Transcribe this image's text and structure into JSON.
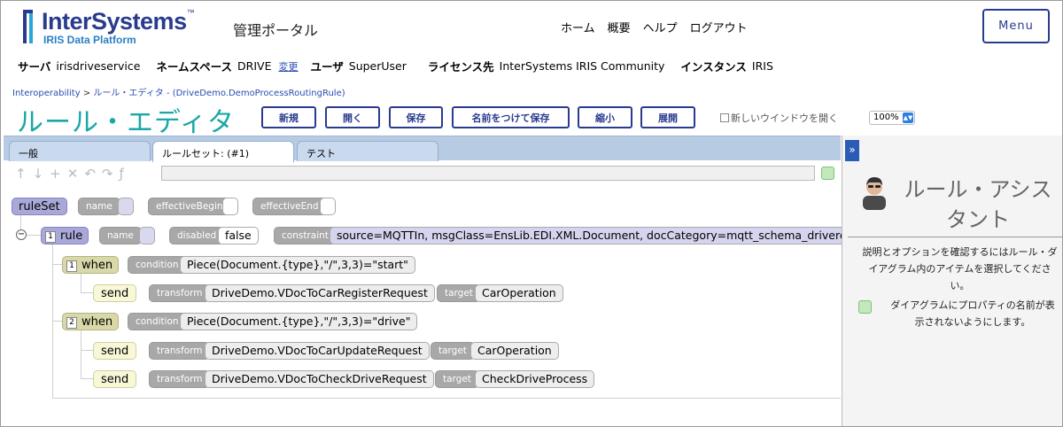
{
  "header": {
    "logo_name": "InterSystems",
    "logo_tm": "™",
    "logo_sub": "IRIS Data Platform",
    "portal_title": "管理ポータル",
    "nav": [
      "ホーム",
      "概要",
      "ヘルプ",
      "ログアウト"
    ],
    "menu_label": "Menu"
  },
  "info": {
    "server_label": "サーバ",
    "server": "irisdriveservice",
    "namespace_label": "ネームスペース",
    "namespace": "DRIVE",
    "change_label": "変更",
    "user_label": "ユーザ",
    "user": "SuperUser",
    "license_label": "ライセンス先",
    "license": "InterSystems IRIS Community",
    "instance_label": "インスタンス",
    "instance": "IRIS"
  },
  "breadcrumb": {
    "root": "Interoperability",
    "sep": ">",
    "current": "ルール・エディタ",
    "detail": " - (DriveDemo.DemoProcessRoutingRule)"
  },
  "page_title": "ルール・エディタ",
  "toolbar": {
    "new": "新規",
    "open": "開く",
    "save": "保存",
    "save_as": "名前をつけて保存",
    "shrink": "縮小",
    "expand": "展開",
    "new_window": "新しいウインドウを開く",
    "zoom": "100%"
  },
  "tabs": [
    "一般",
    "ルールセット: (#1)",
    "テスト"
  ],
  "rule_tools": [
    "↑",
    "↓",
    "+",
    "✕",
    "↶",
    "↷",
    "ƒ"
  ],
  "tree": {
    "ruleset": {
      "label": "ruleSet",
      "attrs": [
        "name",
        "effectiveBegin",
        "effectiveEnd"
      ]
    },
    "rule": {
      "num": "1",
      "label": "rule",
      "name_attr": "name",
      "disabled_attr": "disabled",
      "disabled_val": "false",
      "constraint_attr": "constraint",
      "constraint_val": "source=MQTTIn, msgClass=EnsLib.EDI.XML.Document, docCategory=mqtt_schema_driverecord, do"
    },
    "whens": [
      {
        "num": "1",
        "label": "when",
        "condition_attr": "condition",
        "condition": "Piece(Document.{type},\"/\",3,3)=\"start\"",
        "sends": [
          {
            "label": "send",
            "transform_attr": "transform",
            "transform": "DriveDemo.VDocToCarRegisterRequest",
            "target_attr": "target",
            "target": "CarOperation"
          }
        ]
      },
      {
        "num": "2",
        "label": "when",
        "condition_attr": "condition",
        "condition": "Piece(Document.{type},\"/\",3,3)=\"drive\"",
        "sends": [
          {
            "label": "send",
            "transform_attr": "transform",
            "transform": "DriveDemo.VDocToCarUpdateRequest",
            "target_attr": "target",
            "target": "CarOperation"
          },
          {
            "label": "send",
            "transform_attr": "transform",
            "transform": "DriveDemo.VDocToCheckDriveRequest",
            "target_attr": "target",
            "target": "CheckDriveProcess"
          }
        ]
      }
    ]
  },
  "assistant": {
    "toggle": "»",
    "title": "ルール・アシスタント",
    "help": "説明とオプションを確認するにはルール・ダイアグラム内のアイテムを選択してください。",
    "option": "ダイアグラムにプロパティの名前が表示されないようにします。"
  }
}
